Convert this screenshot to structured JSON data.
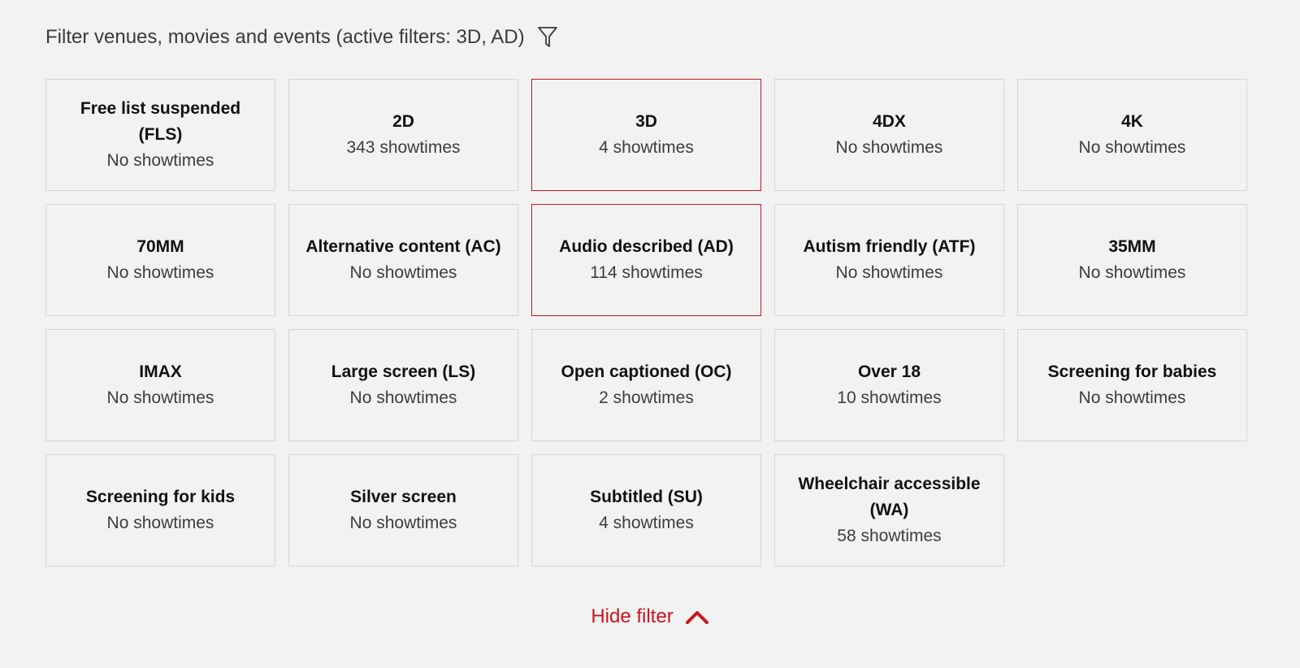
{
  "header": {
    "title": "Filter venues, movies and events (active filters: 3D, AD)",
    "icon": "funnel-icon"
  },
  "accent_color": "#c8161d",
  "filters": [
    {
      "name": "Free list suspended (FLS)",
      "count": "No showtimes",
      "active": false
    },
    {
      "name": "2D",
      "count": "343 showtimes",
      "active": false
    },
    {
      "name": "3D",
      "count": "4 showtimes",
      "active": true
    },
    {
      "name": "4DX",
      "count": "No showtimes",
      "active": false
    },
    {
      "name": "4K",
      "count": "No showtimes",
      "active": false
    },
    {
      "name": "70MM",
      "count": "No showtimes",
      "active": false
    },
    {
      "name": "Alternative content (AC)",
      "count": "No showtimes",
      "active": false
    },
    {
      "name": "Audio described (AD)",
      "count": "114 showtimes",
      "active": true
    },
    {
      "name": "Autism friendly (ATF)",
      "count": "No showtimes",
      "active": false
    },
    {
      "name": "35MM",
      "count": "No showtimes",
      "active": false
    },
    {
      "name": "IMAX",
      "count": "No showtimes",
      "active": false
    },
    {
      "name": "Large screen (LS)",
      "count": "No showtimes",
      "active": false
    },
    {
      "name": "Open captioned (OC)",
      "count": "2 showtimes",
      "active": false
    },
    {
      "name": "Over 18",
      "count": "10 showtimes",
      "active": false
    },
    {
      "name": "Screening for babies",
      "count": "No showtimes",
      "active": false
    },
    {
      "name": "Screening for kids",
      "count": "No showtimes",
      "active": false
    },
    {
      "name": "Silver screen",
      "count": "No showtimes",
      "active": false
    },
    {
      "name": "Subtitled (SU)",
      "count": "4 showtimes",
      "active": false
    },
    {
      "name": "Wheelchair accessible (WA)",
      "count": "58 showtimes",
      "active": false
    }
  ],
  "footer": {
    "hide_label": "Hide filter",
    "icon": "chevron-up-icon"
  }
}
